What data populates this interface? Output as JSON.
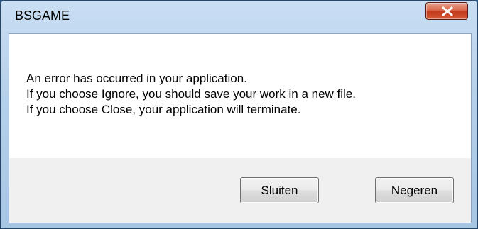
{
  "window": {
    "title": "BSGAME",
    "close_icon": "close-x-icon"
  },
  "message": {
    "lines": [
      "An error has occurred in your application.",
      "If you choose Ignore, you should save your work in a new file.",
      "If you choose Close, your application will terminate."
    ]
  },
  "buttons": {
    "close_label": "Sluiten",
    "ignore_label": "Negeren"
  },
  "colors": {
    "title_bar": "#b4cfe9",
    "close_button": "#c2381c",
    "content_background": "#ffffff",
    "footer_background": "#f0f0f0"
  }
}
